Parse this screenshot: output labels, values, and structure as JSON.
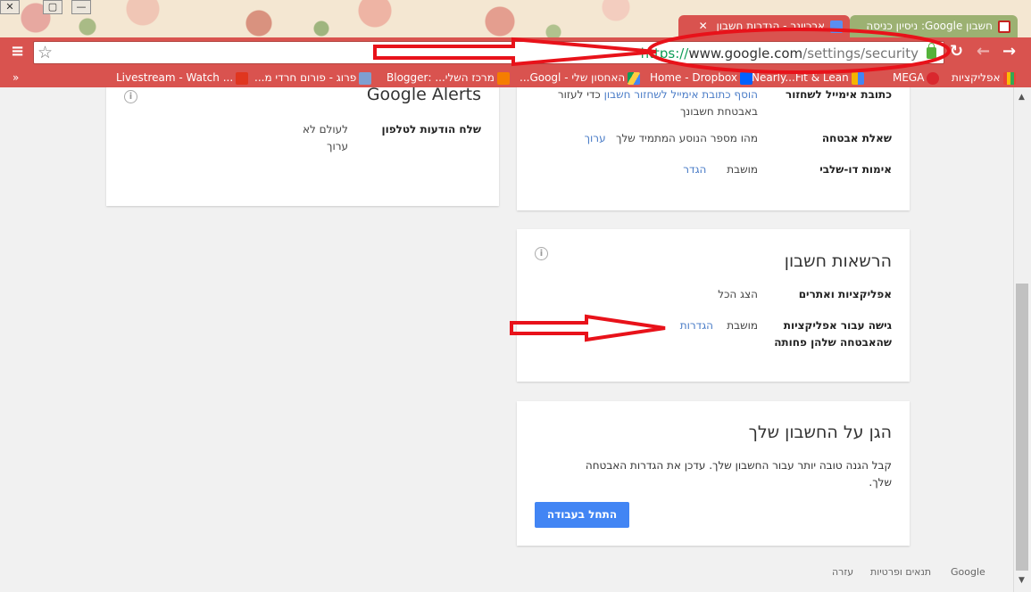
{
  "window": {
    "controls": [
      "✕",
      "▢",
      "—"
    ]
  },
  "tabs": [
    {
      "title": "ארכיונר - הגדרות חשבון",
      "icon": "google-plus-icon",
      "active": true
    },
    {
      "title": "חשבון Google: ניסיון כניסה",
      "icon": "gmail-icon",
      "active": false
    }
  ],
  "toolbar": {
    "url_scheme": "https://",
    "url_host": "www.google.com",
    "url_path": "/settings/security",
    "back": "←",
    "forward": "→",
    "reload": "↻",
    "menu": "≡",
    "star": "☆"
  },
  "bookmarks": {
    "more": "»",
    "items": [
      {
        "label": "אפליקציות",
        "icon": "apps-icon"
      },
      {
        "label": "MEGA",
        "icon": "mega-icon"
      },
      {
        "label": "Nearly...Fit & Lean",
        "icon": "bookmark-icon"
      },
      {
        "label": "Home - Dropbox",
        "icon": "dropbox-icon"
      },
      {
        "label": "האחסון שלי - Googl...",
        "icon": "drive-icon"
      },
      {
        "label": "מרכז השלי... :Blogger",
        "icon": "blogger-icon"
      },
      {
        "label": "פרוג - פורום חרדי מ...",
        "icon": "forum-icon"
      },
      {
        "label": "Livestream - Watch ...",
        "icon": "livestream-icon"
      }
    ]
  },
  "left_card": {
    "title": "Google Alerts",
    "row_label": "שלח הודעות לטלפון",
    "row_value": "לעולם לא",
    "row_link": "ערוך"
  },
  "signin_card": {
    "recovery_label": "כתובת אימייל לשחזור",
    "recovery_link": "הוסף כתובת אימייל לשחזור חשבון",
    "recovery_text": "כדי לעזור",
    "recovery_text2": "באבטחת חשבונך",
    "question_label": "שאלת אבטחה",
    "question_value": "מהו מספר הנוסע המתמיד שלך",
    "question_link": "ערוך",
    "twostep_label": "אימות דו-שלבי",
    "twostep_value": "מושבת",
    "twostep_link": "הגדר"
  },
  "permissions_card": {
    "title": "הרשאות חשבון",
    "apps_label": "אפליקציות ואתרים",
    "apps_link": "הצג הכל",
    "less_secure_label_1": "גישה עבור אפליקציות",
    "less_secure_label_2": "שהאבטחה שלהן פחותה",
    "less_secure_value": "מושבת",
    "less_secure_link": "הגדרות"
  },
  "protect_card": {
    "title": "הגן על החשבון שלך",
    "text_1": "קבל הגנה טובה יותר עבור החשבון שלך. עדכן את הגדרות האבטחה",
    "text_2": "שלך.",
    "button": "התחל בעבודה"
  },
  "footer": {
    "google": "Google",
    "terms": "תנאים ופרטיות",
    "help": "עזרה"
  },
  "annotations": {
    "color": "#e8121a"
  }
}
